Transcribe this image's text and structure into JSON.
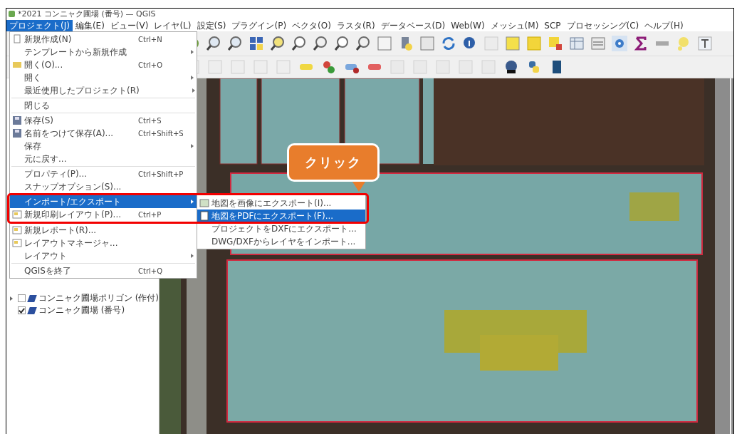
{
  "window": {
    "title": "*2021 コンニャク圃場 (番号) — QGIS"
  },
  "menubar": [
    {
      "label": "プロジェクト(J)",
      "selected": true
    },
    {
      "label": "編集(E)",
      "selected": false
    },
    {
      "label": "ビュー(V)",
      "selected": false
    },
    {
      "label": "レイヤ(L)",
      "selected": false
    },
    {
      "label": "設定(S)",
      "selected": false
    },
    {
      "label": "プラグイン(P)",
      "selected": false
    },
    {
      "label": "ベクタ(O)",
      "selected": false
    },
    {
      "label": "ラスタ(R)",
      "selected": false
    },
    {
      "label": "データベース(D)",
      "selected": false
    },
    {
      "label": "Web(W)",
      "selected": false
    },
    {
      "label": "メッシュ(M)",
      "selected": false
    },
    {
      "label": "SCP",
      "selected": false
    },
    {
      "label": "プロセッシング(C)",
      "selected": false
    },
    {
      "label": "ヘルプ(H)",
      "selected": false
    }
  ],
  "menu": {
    "groups": [
      [
        {
          "kind": "file",
          "label": "新規作成(N)",
          "shortcut": "Ctrl+N",
          "submenu": false,
          "selected": false
        },
        {
          "kind": "plain",
          "label": "テンプレートから新規作成",
          "submenu": true,
          "selected": false
        },
        {
          "kind": "folder",
          "label": "開く(O)...",
          "shortcut": "Ctrl+O",
          "submenu": false,
          "selected": false
        },
        {
          "kind": "plain",
          "label": "開く",
          "submenu": true,
          "selected": false
        },
        {
          "kind": "plain",
          "label": "最近使用したプロジェクト(R)",
          "submenu": true,
          "selected": false
        }
      ],
      [
        {
          "kind": "plain",
          "label": "閉じる",
          "submenu": false,
          "selected": false
        }
      ],
      [
        {
          "kind": "save",
          "label": "保存(S)",
          "shortcut": "Ctrl+S",
          "submenu": false,
          "selected": false
        },
        {
          "kind": "save",
          "label": "名前をつけて保存(A)...",
          "shortcut": "Ctrl+Shift+S",
          "submenu": false,
          "selected": false
        },
        {
          "kind": "plain",
          "label": "保存",
          "submenu": true,
          "selected": false
        },
        {
          "kind": "plain",
          "label": "元に戻す...",
          "submenu": false,
          "selected": false
        }
      ],
      [
        {
          "kind": "plain",
          "label": "プロパティ(P)...",
          "shortcut": "Ctrl+Shift+P",
          "submenu": false,
          "selected": false
        },
        {
          "kind": "plain",
          "label": "スナップオプション(S)...",
          "submenu": false,
          "selected": false
        }
      ],
      [
        {
          "kind": "plain",
          "label": "インポート/エクスポート",
          "submenu": true,
          "selected": true
        },
        {
          "kind": "layout",
          "label": "新規印刷レイアウト(P)...",
          "shortcut": "Ctrl+P",
          "submenu": false,
          "selected": false
        },
        {
          "kind": "layout",
          "label": "新規レポート(R)...",
          "submenu": false,
          "selected": false
        },
        {
          "kind": "layout",
          "label": "レイアウトマネージャ...",
          "submenu": false,
          "selected": false
        },
        {
          "kind": "plain",
          "label": "レイアウト",
          "submenu": true,
          "selected": false
        }
      ],
      [
        {
          "kind": "plain",
          "label": "QGISを終了",
          "shortcut": "Ctrl+Q",
          "submenu": false,
          "selected": false
        }
      ]
    ]
  },
  "submenu": {
    "items": [
      {
        "kind": "image",
        "label": "地図を画像にエクスポート(I)...",
        "selected": false
      },
      {
        "kind": "pdf",
        "label": "地図をPDFにエクスポート(F)...",
        "selected": true
      },
      {
        "kind": "plain",
        "label": "プロジェクトをDXFにエクスポート...",
        "selected": false
      },
      {
        "kind": "plain",
        "label": "DWG/DXFからレイヤをインポート...",
        "selected": false
      }
    ]
  },
  "layers": [
    {
      "label": "コンニャク圃場ポリゴン (作付)",
      "checked": false,
      "expanded": false
    },
    {
      "label": "コンニャク圃場 (番号)",
      "checked": true
    }
  ],
  "callout": {
    "text": "クリック"
  }
}
